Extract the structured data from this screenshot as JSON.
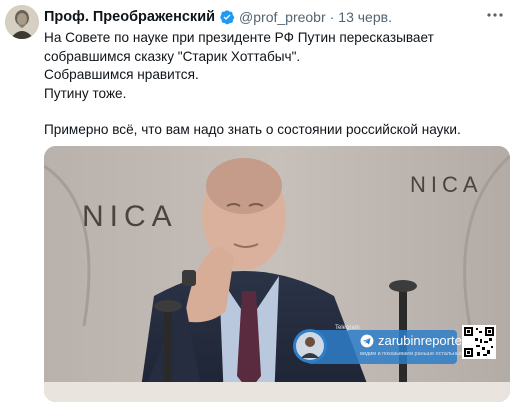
{
  "author": {
    "name": "Проф. Преображенский",
    "handle": "@prof_preobr",
    "separator": "·",
    "date": "13 черв."
  },
  "tweet": {
    "line1": "На Совете по науке при президенте РФ Путин пересказывает",
    "line2": "собравшимся сказку \"Старик Хоттабыч\".",
    "line3": "Собравшимся нравится.",
    "line4": "Путину тоже.",
    "line5": "Примерно всё, что вам надо знать о состоянии российской науки."
  },
  "media": {
    "sign_text": "NICA",
    "sign_text_right": "NICA",
    "watermark_label": "Telegram",
    "watermark_name": "zarubinreporter",
    "watermark_sub": "видим и показываем раньше остальных"
  },
  "icons": {
    "verified": "verified-badge-icon",
    "more": "more-options-icon"
  },
  "colors": {
    "verified": "#1d9bf0",
    "secondary_text": "#536471",
    "primary_text": "#0f1419"
  }
}
